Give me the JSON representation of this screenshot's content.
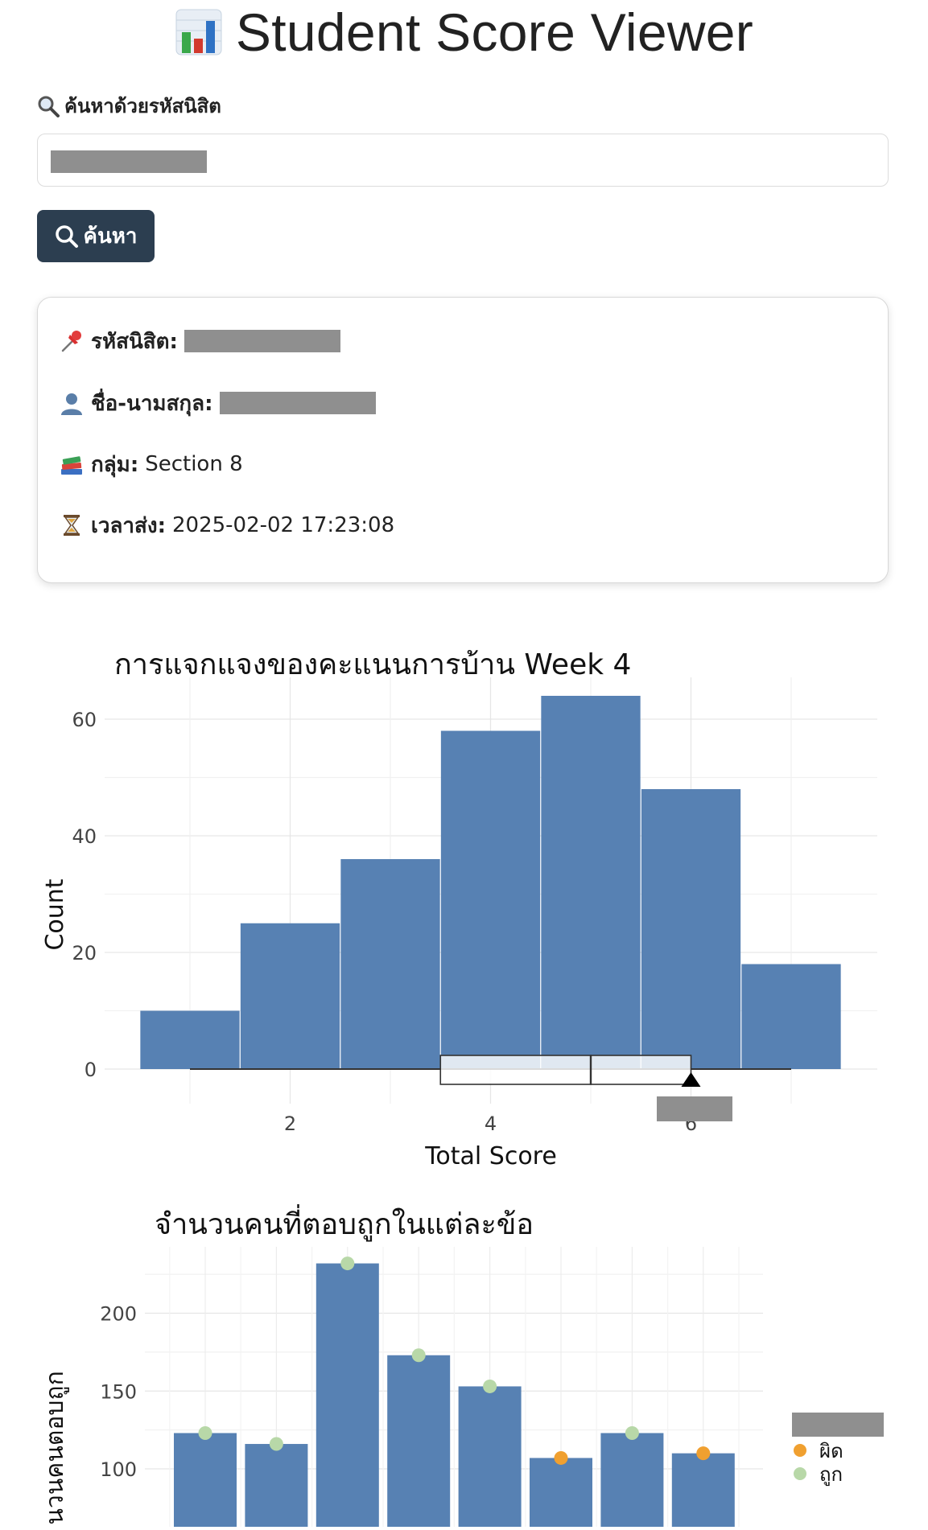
{
  "app": {
    "title": "Student Score Viewer"
  },
  "search": {
    "label": "ค้นหาด้วยรหัสนิสิต",
    "value": "",
    "placeholder": "",
    "button_label": "ค้นหา"
  },
  "student": {
    "id_label": "รหัสนิสิต:",
    "name_label": "ชื่อ-นามสกุล:",
    "group_label": "กลุ่ม:",
    "group_value": "Section 8",
    "time_label": "เวลาส่ง:",
    "time_value": "2025-02-02 17:23:08"
  },
  "colors": {
    "bar": "#5781b3",
    "button": "#2c3e50",
    "wrong": "#f0a030",
    "correct": "#b8d8a8"
  },
  "icons": {
    "search_label": "magnifier-icon",
    "search_button": "search-icon",
    "id": "pushpin-icon",
    "name": "person-icon",
    "group": "books-icon",
    "time": "hourglass-icon",
    "title": "bar-chart-emoji-icon"
  },
  "chart_data": [
    {
      "type": "bar",
      "title": "การแจกแจงของคะแนนการบ้าน Week 4",
      "xlabel": "Total Score",
      "ylabel": "Count",
      "x": [
        1,
        2,
        3,
        4,
        5,
        6,
        7
      ],
      "values": [
        10,
        25,
        36,
        58,
        64,
        48,
        18
      ],
      "xticks": [
        "2",
        "4",
        "6"
      ],
      "yticks": [
        "0",
        "20",
        "40",
        "60"
      ],
      "ylim": [
        0,
        65
      ],
      "grid": true,
      "boxplot": {
        "min": 1,
        "q1": 3.5,
        "median": 5,
        "q3": 6,
        "max": 7
      },
      "marker_x": 6
    },
    {
      "type": "bar",
      "title": "จำนวนคนที่ตอบถูกในแต่ละข้อ",
      "ylabel": "จำนวนคนตอบถูก",
      "values": [
        123,
        116,
        232,
        173,
        153,
        107,
        123,
        110
      ],
      "point_status": [
        "ถูก",
        "ถูก",
        "ถูก",
        "ถูก",
        "ถูก",
        "ผิด",
        "ถูก",
        "ผิด"
      ],
      "yticks": [
        "100",
        "150",
        "200"
      ],
      "ylim": [
        70,
        240
      ],
      "grid": true,
      "legend": {
        "position": "right",
        "entries": [
          "ผิด",
          "ถูก"
        ]
      }
    }
  ]
}
